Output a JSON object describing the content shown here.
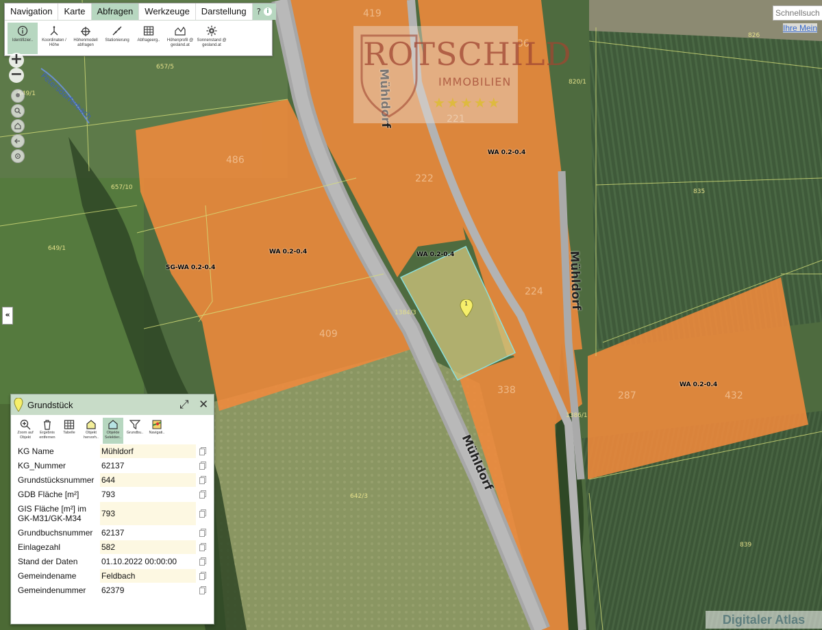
{
  "menu": {
    "items": [
      "Navigation",
      "Karte",
      "Abfragen",
      "Werkzeuge",
      "Darstellung"
    ],
    "active": "Abfragen",
    "help": "?"
  },
  "toolbar": [
    {
      "label": "Identifizier..",
      "icon": "info-icon",
      "active": true
    },
    {
      "label": "Koordinaten / Höhe",
      "icon": "coordinates-icon"
    },
    {
      "label": "Höhenmodell abfragen",
      "icon": "height-model-icon"
    },
    {
      "label": "Stationierung",
      "icon": "stationing-icon"
    },
    {
      "label": "Abfrageerg..",
      "icon": "table-icon"
    },
    {
      "label": "Höhenprofil @ gesland.at",
      "icon": "height-profile-icon"
    },
    {
      "label": "Sonnenstand @ gesland.at",
      "icon": "sun-gear-icon"
    }
  ],
  "search": {
    "placeholder": "Schnellsuch",
    "link": "Ihre Mein"
  },
  "watermark": {
    "line1": "ROTSCHILD",
    "line2": "IMMOBILIEN"
  },
  "attribution": "Digitaler Atlas",
  "map_labels": {
    "parcels": [
      "419",
      "36",
      "826",
      "657/5",
      "649/1",
      "820/1",
      "486",
      "221",
      "657/10",
      "222",
      "835",
      "224",
      "409",
      "338",
      "287",
      "432",
      "642/3",
      "839",
      "1384/3",
      "1386/1",
      "649/1"
    ],
    "zones": [
      "WA 0.2-0.4",
      "WA 0.2-0.4",
      "WA 0.2-0.4",
      "SG-WA 0.2-0.4",
      "WA 0.2-0.4"
    ],
    "streets": [
      "Mühldorf",
      "Mühldorf",
      "Mühldorf"
    ],
    "creek": "Petersdorferbach",
    "marker": "1"
  },
  "panel": {
    "title": "Grundstück",
    "tools": [
      {
        "label": "Zoom auf Objekt",
        "icon": "zoom-object-icon"
      },
      {
        "label": "Ergebnis entfernen",
        "icon": "trash-icon"
      },
      {
        "label": "Tabelle",
        "icon": "table-icon"
      },
      {
        "label": "Objekt hervorh..",
        "icon": "highlight-object-icon"
      },
      {
        "label": "Objekte Selektier..",
        "icon": "select-objects-icon",
        "active": true
      },
      {
        "label": "Grundbu..",
        "icon": "filter-icon"
      },
      {
        "label": "Navigati..",
        "icon": "navigation-icon"
      }
    ],
    "rows": [
      {
        "key": "KG Name",
        "value": "Mühldorf",
        "highlight": true
      },
      {
        "key": "KG_Nummer",
        "value": "62137"
      },
      {
        "key": "Grundstücksnummer",
        "value": "644",
        "highlight": true
      },
      {
        "key": "GDB Fläche [m²]",
        "value": "793"
      },
      {
        "key": "GIS Fläche [m²] im GK-M31/GK-M34",
        "value": "793",
        "highlight": true
      },
      {
        "key": "Grundbuchsnummer",
        "value": "62137"
      },
      {
        "key": "Einlagezahl",
        "value": "582",
        "highlight": true
      },
      {
        "key": "Stand der Daten",
        "value": "01.10.2022 00:00:00"
      },
      {
        "key": "Gemeindename",
        "value": "Feldbach",
        "highlight": true
      },
      {
        "key": "Gemeindenummer",
        "value": "62379"
      }
    ]
  },
  "colors": {
    "zone": "#f08a3c",
    "selected_parcel": "#c9c07a",
    "panel_header": "#c8dcc8",
    "menu_active": "#b7d7c0"
  }
}
